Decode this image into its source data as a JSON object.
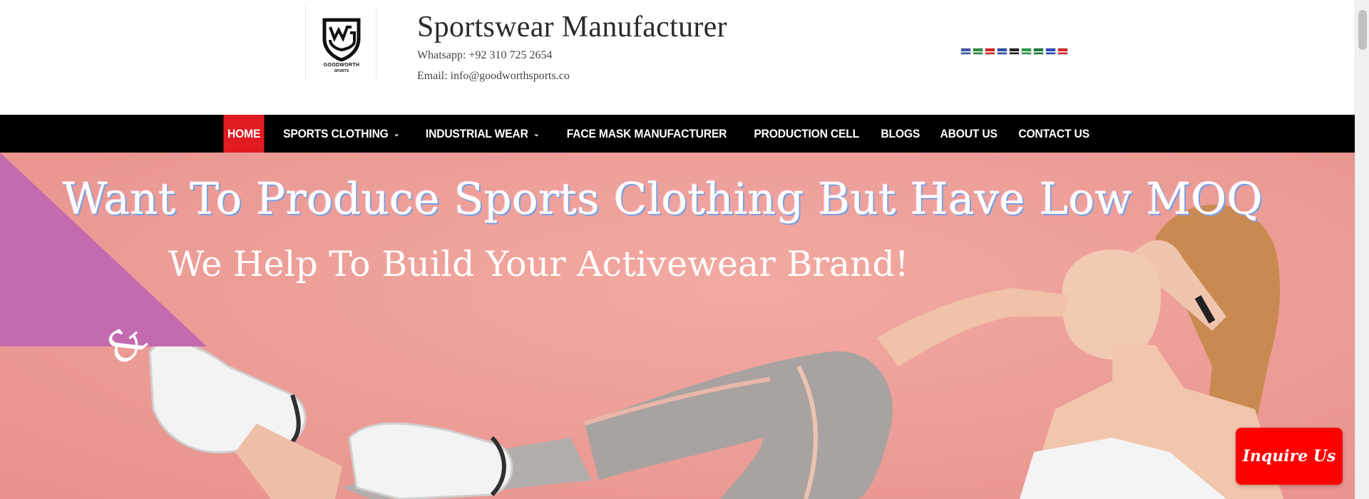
{
  "header": {
    "logo_text_1": "GOODWORTH",
    "logo_text_2": "SPORTS",
    "title": "Sportswear Manufacturer",
    "whatsapp": "Whatsapp: +92 310 725 2654",
    "email": "Email: info@goodworthsports.co",
    "flags": [
      {
        "name": "english-flag-icon",
        "color": "#3c5aa6"
      },
      {
        "name": "arabic-flag-icon",
        "color": "#2a8a3e"
      },
      {
        "name": "chinese-flag-icon",
        "color": "#d7261e"
      },
      {
        "name": "french-flag-icon",
        "color": "#2a4fa0"
      },
      {
        "name": "german-flag-icon",
        "color": "#222222"
      },
      {
        "name": "italian-flag-icon",
        "color": "#2a9a4a"
      },
      {
        "name": "portuguese-flag-icon",
        "color": "#1f7a3a"
      },
      {
        "name": "russian-flag-icon",
        "color": "#2b4cc0"
      },
      {
        "name": "spanish-flag-icon",
        "color": "#d9262a"
      }
    ]
  },
  "nav": {
    "items": [
      {
        "label": "HOME",
        "active": true,
        "dropdown": false
      },
      {
        "label": "SPORTS CLOTHING",
        "active": false,
        "dropdown": true
      },
      {
        "label": "INDUSTRIAL WEAR",
        "active": false,
        "dropdown": true
      },
      {
        "label": "FACE MASK MANUFACTURER",
        "active": false,
        "dropdown": false
      },
      {
        "label": "PRODUCTION CELL",
        "active": false,
        "dropdown": false
      },
      {
        "label": "BLOGS",
        "active": false,
        "dropdown": false
      },
      {
        "label": "ABOUT US",
        "active": false,
        "dropdown": false
      },
      {
        "label": "CONTACT US",
        "active": false,
        "dropdown": false
      }
    ]
  },
  "hero": {
    "headline": "Want To Produce Sports Clothing But Have Low MOQ",
    "subheadline": "We Help To Build Your Activewear Brand!"
  },
  "inquire": {
    "label": "Inquire Us"
  },
  "colors": {
    "accent": "#e11b22",
    "nav_bg": "#000000",
    "hero_bg": "#ee9f98",
    "triangle": "#c46bb0",
    "inquire_bg": "#fe0000"
  }
}
